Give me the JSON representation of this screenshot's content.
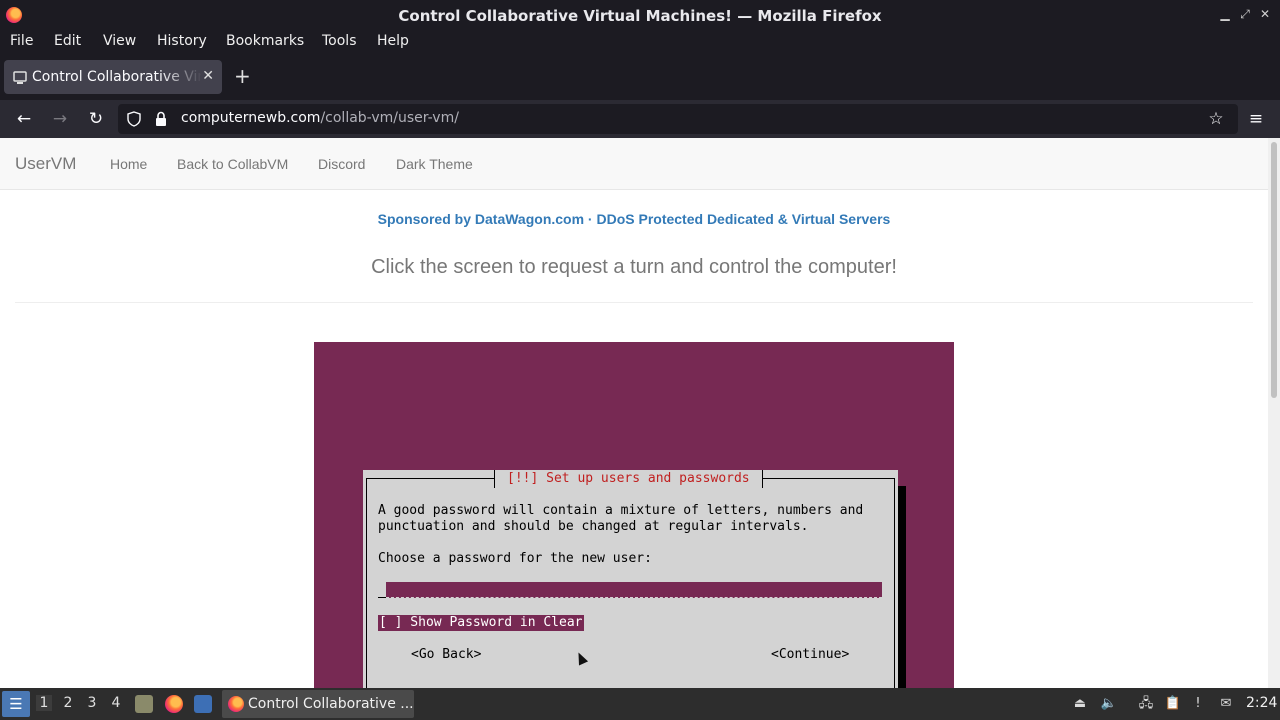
{
  "window": {
    "title": "Control Collaborative Virtual Machines! — Mozilla Firefox",
    "minimize_glyph": "▁",
    "maximize_glyph": "⤢",
    "close_glyph": "✕"
  },
  "menubar": {
    "items": [
      "File",
      "Edit",
      "View",
      "History",
      "Bookmarks",
      "Tools",
      "Help"
    ]
  },
  "tabs": [
    {
      "title": "Control Collaborative Virtual Machines!",
      "active": true
    }
  ],
  "newtab_glyph": "+",
  "toolbar": {
    "back_glyph": "←",
    "forward_glyph": "→",
    "reload_glyph": "↻",
    "menu_glyph": "≡",
    "bookmark_glyph": "☆"
  },
  "url": {
    "domain": "computernewb.com",
    "path": "/collab-vm/user-vm/"
  },
  "site": {
    "brand": "UserVM",
    "nav": [
      "Home",
      "Back to CollabVM",
      "Discord",
      "Dark Theme"
    ],
    "sponsor": "Sponsored by DataWagon.com · DDoS Protected Dedicated & Virtual Servers",
    "lead": "Click the screen to request a turn and control the computer!"
  },
  "vm_dialog": {
    "title": "[!!] Set up users and passwords",
    "text_line1": "A good password will contain a mixture of letters, numbers and",
    "text_line2": "punctuation and should be changed at regular intervals.",
    "prompt": "Choose a password for the new user:",
    "password_value": "",
    "checkbox_label": "[ ] Show Password in Clear",
    "go_back": "<Go Back>",
    "continue": "<Continue>"
  },
  "taskbar": {
    "start_glyph": "☰",
    "workspaces": [
      "1",
      "2",
      "3",
      "4"
    ],
    "active_workspace": "1",
    "task_label": "Control Collaborative ...",
    "clock": "2:24"
  },
  "colors": {
    "chrome_dark": "#1c1b22",
    "vm_background": "#772953",
    "dialog_gray": "#d3d3d3",
    "dialog_title_red": "#c02020",
    "link_blue": "#337ab7"
  }
}
